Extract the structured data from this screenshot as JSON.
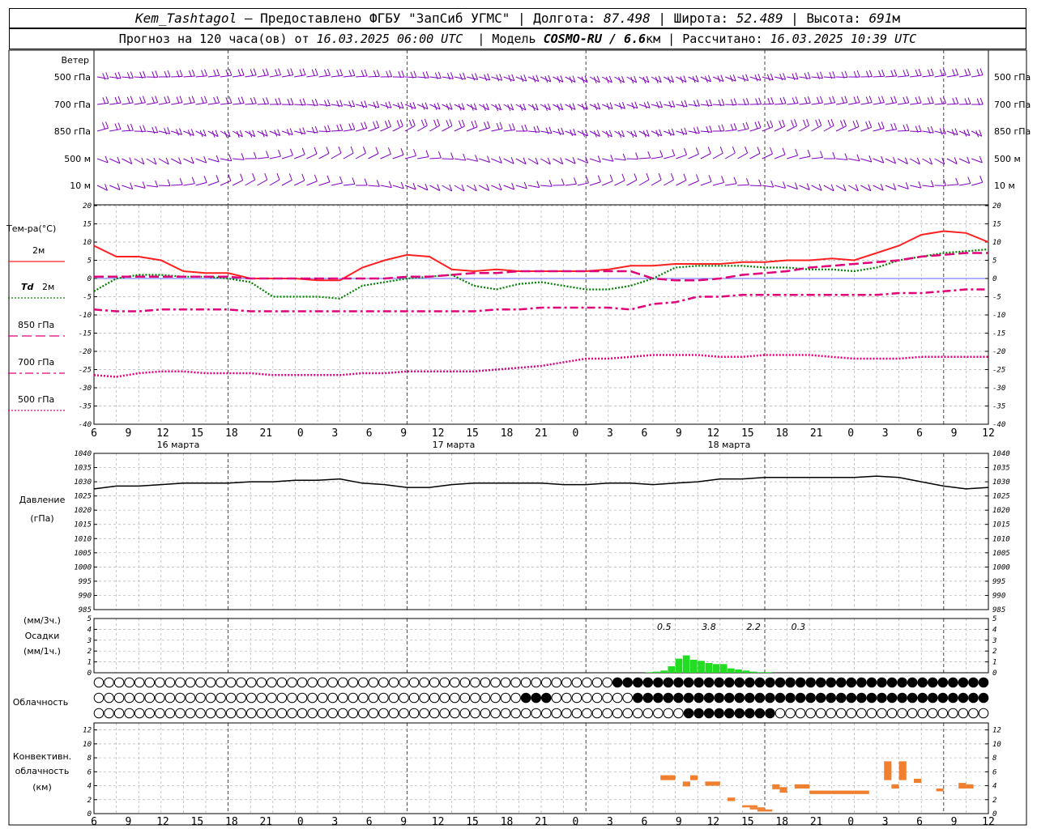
{
  "header": {
    "station": "Kem_Tashtagol",
    "provider": " – Предоставлено ФГБУ \"ЗапСиб УГМС\" | ",
    "lon_label": "Долгота: ",
    "lon": "87.498",
    "lat_label": " | Широта: ",
    "lat": "52.489",
    "alt_label": " | Высота: ",
    "alt": "691",
    "alt_unit": "м",
    "forecast_label": "Прогноз на 120 часа(ов) от ",
    "forecast_start": "16.03.2025 06:00 UTC",
    "model_label": "  | Модель ",
    "model": "COSMO-RU / 6.6",
    "model_unit": "км",
    "calc_label": " | Рассчитано: ",
    "calc_time": "16.03.2025 10:39 UTC"
  },
  "colors": {
    "wind": "#8000c0",
    "t2m": "#ff2020",
    "td2m": "#008000",
    "t850": "#e0007a",
    "t700": "#e0007a",
    "t500": "#e0007a",
    "pressure": "#000000",
    "precip": "#22dd22",
    "conv": "#f08030",
    "grid": "#b0b0b0"
  },
  "wind_panel": {
    "title": "Ветер",
    "levels": [
      "500 гПа",
      "700 гПа",
      "850 гПа",
      "500 м",
      "10  м"
    ]
  },
  "temp_panel": {
    "title": "Тем-ра(°C)",
    "legend": [
      {
        "label": "2м",
        "style": "solid"
      },
      {
        "label_italic": "Td",
        "label": "2м",
        "style": "dotted-green"
      },
      {
        "label": "850 гПа",
        "style": "longdash"
      },
      {
        "label": "700 гПа",
        "style": "dashdot"
      },
      {
        "label": "500 гПа",
        "style": "dotted"
      }
    ],
    "yticks": [
      "20",
      "15",
      "10",
      "5",
      "0",
      "-5",
      "-10",
      "-15",
      "-20",
      "-25",
      "-30",
      "-35",
      "-40"
    ]
  },
  "time_axis": {
    "hour_labels": [
      "6",
      "9",
      "12",
      "15",
      "18",
      "21",
      "0",
      "3",
      "6",
      "9",
      "12",
      "15",
      "18",
      "21",
      "0",
      "3",
      "6",
      "9",
      "12",
      "15",
      "18",
      "21",
      "0",
      "3",
      "6",
      "9",
      "12"
    ],
    "dates": [
      "16 марта",
      "17 марта",
      "18 марта"
    ]
  },
  "pressure_panel": {
    "title": "Давление",
    "unit": "(гПа)",
    "yticks": [
      "1040",
      "1035",
      "1030",
      "1025",
      "1020",
      "1015",
      "1010",
      "1005",
      "1000",
      "995",
      "990",
      "985"
    ]
  },
  "precip_panel": {
    "unit3": "(мм/3ч.)",
    "title": "Осадки",
    "unit1": "(мм/1ч.)",
    "yticks": [
      "5",
      "4",
      "3",
      "2",
      "1",
      "0"
    ],
    "totals": [
      "0.5",
      "3.8",
      "2.2",
      "0.3"
    ]
  },
  "cloud_panel": {
    "title": "Облачность"
  },
  "conv_panel": {
    "title1": "Конвективн.",
    "title2": "облачность",
    "unit": "(км)",
    "yticks": [
      "12",
      "10",
      "8",
      "6",
      "4",
      "2",
      "0"
    ]
  },
  "chart_data": [
    {
      "type": "line",
      "title": "Тем-ра(°C)",
      "x_hours": [
        0,
        3,
        6,
        9,
        12,
        15,
        18,
        21,
        24,
        27,
        30,
        33,
        36,
        39,
        42,
        45,
        48,
        51,
        54,
        57,
        60,
        63,
        66,
        69,
        72,
        75,
        78,
        81,
        84,
        87,
        90,
        93,
        96,
        99,
        102,
        105,
        108,
        111,
        114,
        117,
        120
      ],
      "ylim": [
        -40,
        20
      ],
      "series": [
        {
          "name": "2м",
          "values": [
            9,
            6,
            6,
            5,
            2,
            1.5,
            1.5,
            0,
            0,
            0,
            -0.5,
            -0.5,
            3,
            5,
            6.5,
            6,
            2.5,
            2,
            2.5,
            2,
            2,
            2,
            2,
            2.5,
            3.5,
            3.5,
            4,
            4,
            4,
            4.5,
            4.5,
            5,
            5,
            5.5,
            5,
            7,
            9,
            12,
            13,
            12.5,
            10
          ]
        },
        {
          "name": "Td 2м",
          "values": [
            -3.5,
            0,
            1,
            1,
            0.5,
            0.5,
            0,
            -1,
            -5,
            -5,
            -5,
            -5.5,
            -2,
            -1,
            0,
            0.5,
            1,
            -2,
            -3,
            -1.5,
            -1,
            -2,
            -3,
            -3,
            -2,
            0,
            3,
            3.5,
            3.5,
            3.5,
            3,
            3,
            2.5,
            2.5,
            2,
            3,
            5,
            6,
            7,
            7.5,
            8
          ]
        },
        {
          "name": "850 гПа",
          "values": [
            0.5,
            0.5,
            0.5,
            0.5,
            0.5,
            0.5,
            0.5,
            0,
            0,
            0,
            0,
            0,
            0,
            0,
            0.5,
            0.5,
            1,
            1.5,
            1.5,
            2,
            2,
            2,
            2,
            2,
            2,
            0,
            -0.5,
            -0.5,
            0,
            1,
            1.5,
            2,
            3,
            3.5,
            4,
            4.5,
            5,
            6,
            6.5,
            7,
            7
          ]
        },
        {
          "name": "700 гПа",
          "values": [
            -8.5,
            -9,
            -9,
            -8.5,
            -8.5,
            -8.5,
            -8.5,
            -9,
            -9,
            -9,
            -9,
            -9,
            -9,
            -9,
            -9,
            -9,
            -9,
            -9,
            -8.5,
            -8.5,
            -8,
            -8,
            -8,
            -8,
            -8.5,
            -7,
            -6.5,
            -5,
            -5,
            -4.5,
            -4.5,
            -4.5,
            -4.5,
            -4.5,
            -4.5,
            -4.5,
            -4,
            -4,
            -3.5,
            -3,
            -3
          ]
        },
        {
          "name": "500 гПа",
          "values": [
            -26.5,
            -27,
            -26,
            -25.5,
            -25.5,
            -26,
            -26,
            -26,
            -26.5,
            -26.5,
            -26.5,
            -26.5,
            -26,
            -26,
            -25.5,
            -25.5,
            -25.5,
            -25.5,
            -25,
            -24.5,
            -24,
            -23,
            -22,
            -22,
            -21.5,
            -21,
            -21,
            -21,
            -21.5,
            -21.5,
            -21,
            -21,
            -21,
            -21.5,
            -22,
            -22,
            -22,
            -21.5,
            -21.5,
            -21.5,
            -21.5
          ]
        }
      ]
    },
    {
      "type": "line",
      "title": "Давление",
      "x_hours": [
        0,
        3,
        6,
        9,
        12,
        15,
        18,
        21,
        24,
        27,
        30,
        33,
        36,
        39,
        42,
        45,
        48,
        51,
        54,
        57,
        60,
        63,
        66,
        69,
        72,
        75,
        78,
        81,
        84,
        87,
        90,
        93,
        96,
        99,
        102,
        105,
        108,
        111,
        114,
        117,
        120
      ],
      "ylim": [
        985,
        1040
      ],
      "series": [
        {
          "name": "Давление",
          "values": [
            1027.5,
            1028.5,
            1028.5,
            1029,
            1029.5,
            1029.5,
            1029.5,
            1030,
            1030,
            1030.5,
            1030.5,
            1031,
            1029.5,
            1029,
            1028,
            1028,
            1029,
            1029.5,
            1029.5,
            1029.5,
            1029.5,
            1029,
            1029,
            1029.5,
            1029.5,
            1029,
            1029.5,
            1030,
            1031,
            1031,
            1031.5,
            1031.5,
            1031.5,
            1031.5,
            1031.5,
            1032,
            1031.5,
            1030,
            1028.5,
            1027.5,
            1028
          ]
        }
      ]
    },
    {
      "type": "bar",
      "title": "Осадки",
      "x_hours": [
        74,
        75,
        76,
        77,
        78,
        79,
        80,
        81,
        82,
        83,
        84,
        85,
        86,
        87,
        88,
        89,
        90
      ],
      "ylim": [
        0,
        5
      ],
      "values": [
        0.05,
        0.1,
        0.2,
        0.6,
        1.3,
        1.6,
        1.2,
        1.1,
        0.9,
        0.8,
        0.8,
        0.4,
        0.3,
        0.2,
        0.1,
        0.05,
        0.05
      ]
    },
    {
      "type": "bar",
      "title": "Конвективн. облачность",
      "ylim": [
        0,
        13
      ],
      "bars": [
        {
          "x0": 76,
          "x1": 78,
          "bottom": 4.8,
          "top": 5.5
        },
        {
          "x0": 79,
          "x1": 80,
          "bottom": 3.9,
          "top": 4.6
        },
        {
          "x0": 80,
          "x1": 81,
          "bottom": 4.8,
          "top": 5.5
        },
        {
          "x0": 82,
          "x1": 84,
          "bottom": 4.0,
          "top": 4.6
        },
        {
          "x0": 85,
          "x1": 86,
          "bottom": 1.8,
          "top": 2.3
        },
        {
          "x0": 87,
          "x1": 89,
          "bottom": 0.9,
          "top": 1.2
        },
        {
          "x0": 88,
          "x1": 90,
          "bottom": 0.6,
          "top": 0.9
        },
        {
          "x0": 89,
          "x1": 91,
          "bottom": 0.3,
          "top": 0.6
        },
        {
          "x0": 91,
          "x1": 92,
          "bottom": 3.5,
          "top": 4.2
        },
        {
          "x0": 92,
          "x1": 93,
          "bottom": 3.0,
          "top": 3.8
        },
        {
          "x0": 94,
          "x1": 96,
          "bottom": 3.6,
          "top": 4.2
        },
        {
          "x0": 96,
          "x1": 99,
          "bottom": 2.8,
          "top": 3.3
        },
        {
          "x0": 99,
          "x1": 102,
          "bottom": 2.8,
          "top": 3.3
        },
        {
          "x0": 102,
          "x1": 104,
          "bottom": 2.8,
          "top": 3.3
        },
        {
          "x0": 106,
          "x1": 107,
          "bottom": 4.8,
          "top": 7.5
        },
        {
          "x0": 107,
          "x1": 108,
          "bottom": 3.6,
          "top": 4.2
        },
        {
          "x0": 108,
          "x1": 109,
          "bottom": 4.8,
          "top": 7.5
        },
        {
          "x0": 110,
          "x1": 111,
          "bottom": 4.4,
          "top": 5.0
        },
        {
          "x0": 113,
          "x1": 114,
          "bottom": 3.2,
          "top": 3.6
        },
        {
          "x0": 116,
          "x1": 117,
          "bottom": 3.6,
          "top": 4.4
        },
        {
          "x0": 117,
          "x1": 118,
          "bottom": 3.6,
          "top": 4.2
        }
      ]
    }
  ]
}
